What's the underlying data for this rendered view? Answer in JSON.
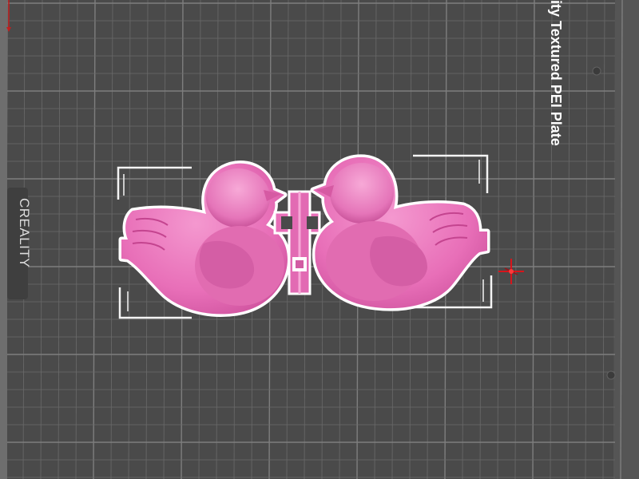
{
  "viewport": {
    "plate_label": "ity Textured PEI Plate",
    "brand": "CREALITY",
    "colors": {
      "background": "#5b5b5b",
      "plate": "#4c4c4c",
      "grid_minor": "#6a6a6a",
      "grid_major": "#7e7e7e",
      "model_fill": "#e86fb8",
      "model_outline": "#ffffff",
      "bbox_lines": "#ffffff",
      "origin_marker": "#d8141b"
    }
  },
  "objects": [
    {
      "name": "duck-mold-half-left",
      "icon": "duck-shape"
    },
    {
      "name": "hinge-connector",
      "icon": "hinge-shape"
    },
    {
      "name": "duck-mold-half-right",
      "icon": "duck-shape"
    }
  ],
  "markers": {
    "rotation_center": "crosshair-icon",
    "axis_indicator": "axis-arrow-icon"
  }
}
